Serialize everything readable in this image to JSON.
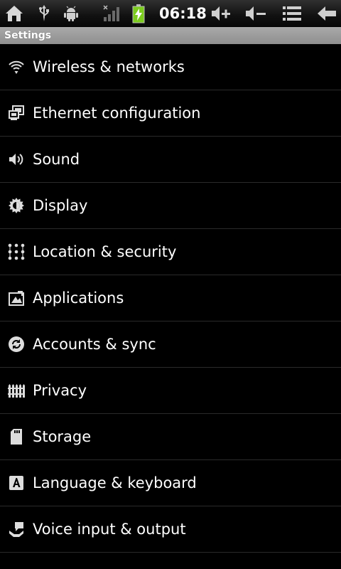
{
  "status_bar": {
    "time": "06:18",
    "icons": [
      "home-icon",
      "usb-icon",
      "android-debug-icon",
      "signal-icon",
      "battery-charging-icon",
      "volume-up-icon",
      "volume-down-icon",
      "menu-icon",
      "back-icon"
    ]
  },
  "title_bar": {
    "title": "Settings"
  },
  "settings": {
    "items": [
      {
        "label": "Wireless & networks",
        "icon": "wifi-icon"
      },
      {
        "label": "Ethernet configuration",
        "icon": "ethernet-icon"
      },
      {
        "label": "Sound",
        "icon": "speaker-icon"
      },
      {
        "label": "Display",
        "icon": "brightness-icon"
      },
      {
        "label": "Location & security",
        "icon": "lock-pattern-icon"
      },
      {
        "label": "Applications",
        "icon": "applications-icon"
      },
      {
        "label": "Accounts & sync",
        "icon": "sync-icon"
      },
      {
        "label": "Privacy",
        "icon": "privacy-fence-icon"
      },
      {
        "label": "Storage",
        "icon": "sd-card-icon"
      },
      {
        "label": "Language & keyboard",
        "icon": "keyboard-letter-icon"
      },
      {
        "label": "Voice input & output",
        "icon": "voice-icon"
      }
    ]
  },
  "colors": {
    "background": "#000000",
    "title_bar": "#9a9a9a",
    "text": "#ffffff",
    "divider": "#2a2a2a",
    "battery_charge": "#7ccc1e"
  }
}
